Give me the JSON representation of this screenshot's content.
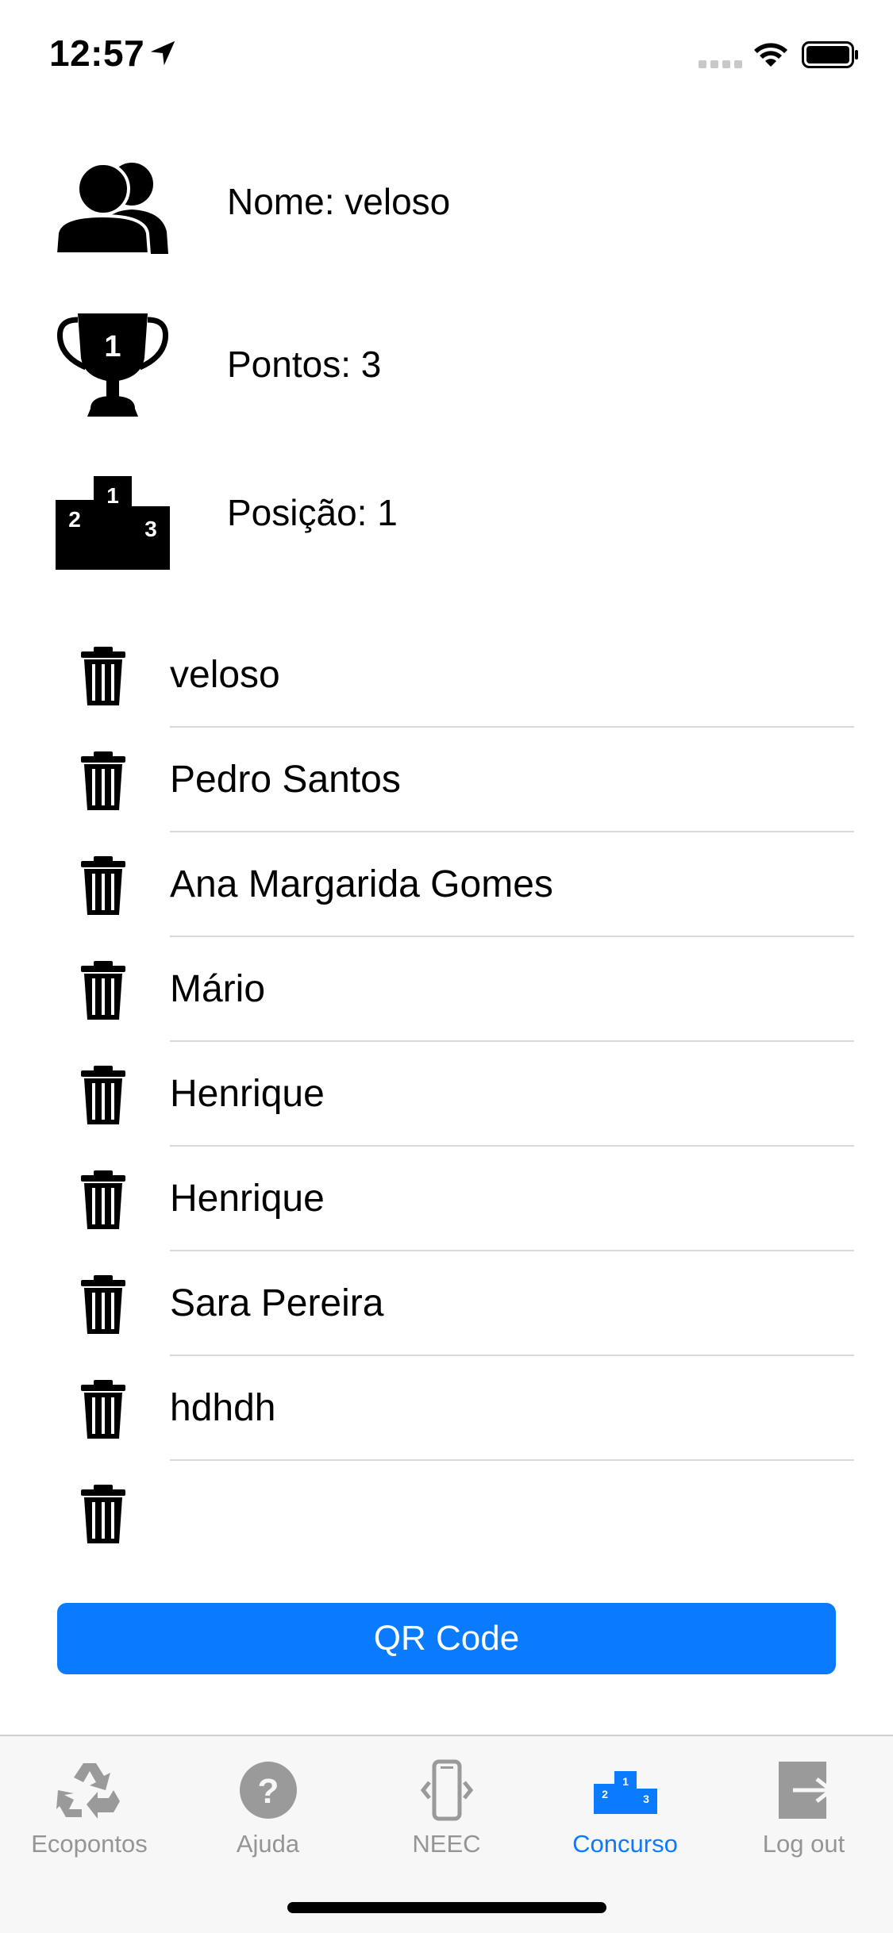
{
  "status_bar": {
    "time": "12:57"
  },
  "profile": {
    "name_text": "Nome: veloso",
    "points_text": "Pontos: 3",
    "position_text": "Posição: 1"
  },
  "players": [
    {
      "name": "veloso"
    },
    {
      "name": "Pedro Santos"
    },
    {
      "name": "Ana Margarida Gomes"
    },
    {
      "name": "Mário"
    },
    {
      "name": "Henrique"
    },
    {
      "name": "Henrique"
    },
    {
      "name": "Sara Pereira"
    },
    {
      "name": "hdhdh"
    },
    {
      "name": ""
    }
  ],
  "qr_button": {
    "label": "QR Code"
  },
  "tabs": [
    {
      "label": "Ecopontos",
      "icon": "recycle-icon"
    },
    {
      "label": "Ajuda",
      "icon": "help-icon"
    },
    {
      "label": "NEEC",
      "icon": "phone-icon"
    },
    {
      "label": "Concurso",
      "icon": "podium-icon",
      "active": true
    },
    {
      "label": "Log out",
      "icon": "logout-icon"
    }
  ],
  "colors": {
    "accent": "#0a7bff",
    "tab_inactive": "#959595"
  }
}
